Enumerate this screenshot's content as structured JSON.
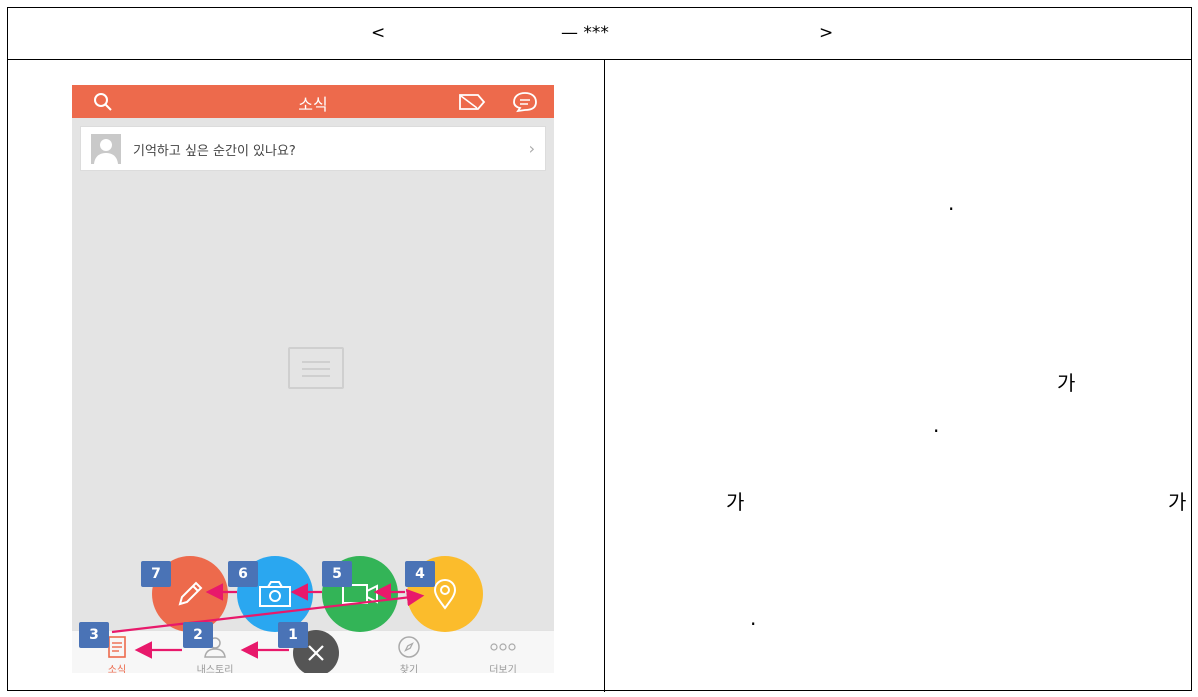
{
  "header": {
    "left": "<",
    "mid": "— ***",
    "right": ">"
  },
  "phone": {
    "title": "소식",
    "compose_placeholder": "기억하고 싶은 순간이 있나요?",
    "tabs": [
      {
        "label": "소식",
        "icon": "news-icon"
      },
      {
        "label": "내스토리",
        "icon": "person-icon"
      },
      {
        "label": "찾기",
        "icon": "compass-icon"
      },
      {
        "label": "더보기",
        "icon": "more-icon"
      }
    ],
    "fabs": [
      {
        "label": "write",
        "icon": "pencil-icon",
        "color": "#ed6a4c"
      },
      {
        "label": "photo",
        "icon": "camera-icon",
        "color": "#2aa7f0"
      },
      {
        "label": "video",
        "icon": "video-icon",
        "color": "#33b457"
      },
      {
        "label": "location",
        "icon": "location-pin-icon",
        "color": "#fbbc2c"
      }
    ],
    "accent": "#ed6a4c"
  },
  "badges": [
    "1",
    "2",
    "3",
    "4",
    "5",
    "6",
    "7"
  ],
  "annotation_color": "#e8196b",
  "right_text": {
    "t1": ".",
    "t2": "가",
    "t3": ".",
    "t4": "가",
    "t5": "가",
    "t6": "."
  }
}
